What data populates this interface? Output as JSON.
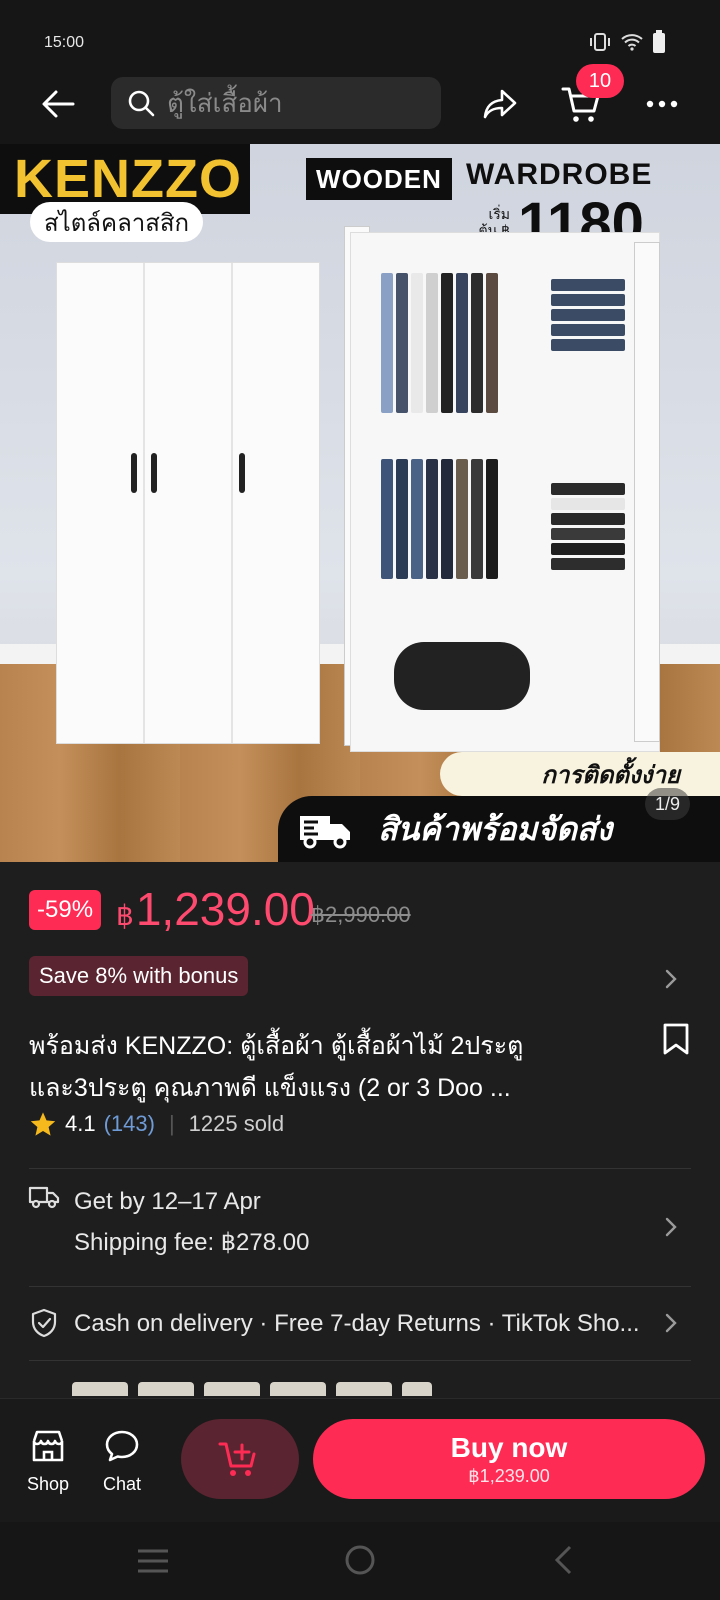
{
  "status_bar": {
    "time": "15:00"
  },
  "topbar": {
    "search_placeholder": "ตู้ใส่เสื้อผ้า",
    "cart_count": "10"
  },
  "hero": {
    "brand": "KENZZO",
    "classic_label": "สไตล์คลาสสิก",
    "headline_1": "WOODEN",
    "headline_2": "WARDROBE",
    "start_label": "เริ่มต้น ฿",
    "start_price": "1180",
    "banner_install": "การติดตั้งง่าย",
    "banner_ready": "สินค้าพร้อมจัดส่ง",
    "page_indicator": "1/9"
  },
  "price": {
    "discount": "-59%",
    "currency": "฿",
    "current": "1,239.00",
    "original": "฿2,990.00"
  },
  "bonus": {
    "label": "Save 8% with bonus"
  },
  "product": {
    "title": "พร้อมส่ง KENZZO: ตู้เสื้อผ้า ตู้เสื้อผ้าไม้ 2ประตู และ3ประตู คุณภาพดี แข็งแรง (2 or 3 Doo ...",
    "rating": "4.1",
    "rating_count": "(143)",
    "sold": "1225 sold"
  },
  "shipping": {
    "delivery": "Get by 12–17 Apr",
    "fee": "Shipping fee: ฿278.00"
  },
  "services": {
    "text": "Cash on delivery · Free 7-day Returns · TikTok Sho..."
  },
  "bottom_bar": {
    "shop_label": "Shop",
    "chat_label": "Chat",
    "buy_label": "Buy now",
    "buy_price": "฿1,239.00"
  },
  "colors": {
    "accent": "#fe2c55",
    "background": "#1e1e1e",
    "bonus_chip": "#5a2430",
    "rating_link": "#6f9bd6",
    "star": "#f5b91e"
  }
}
